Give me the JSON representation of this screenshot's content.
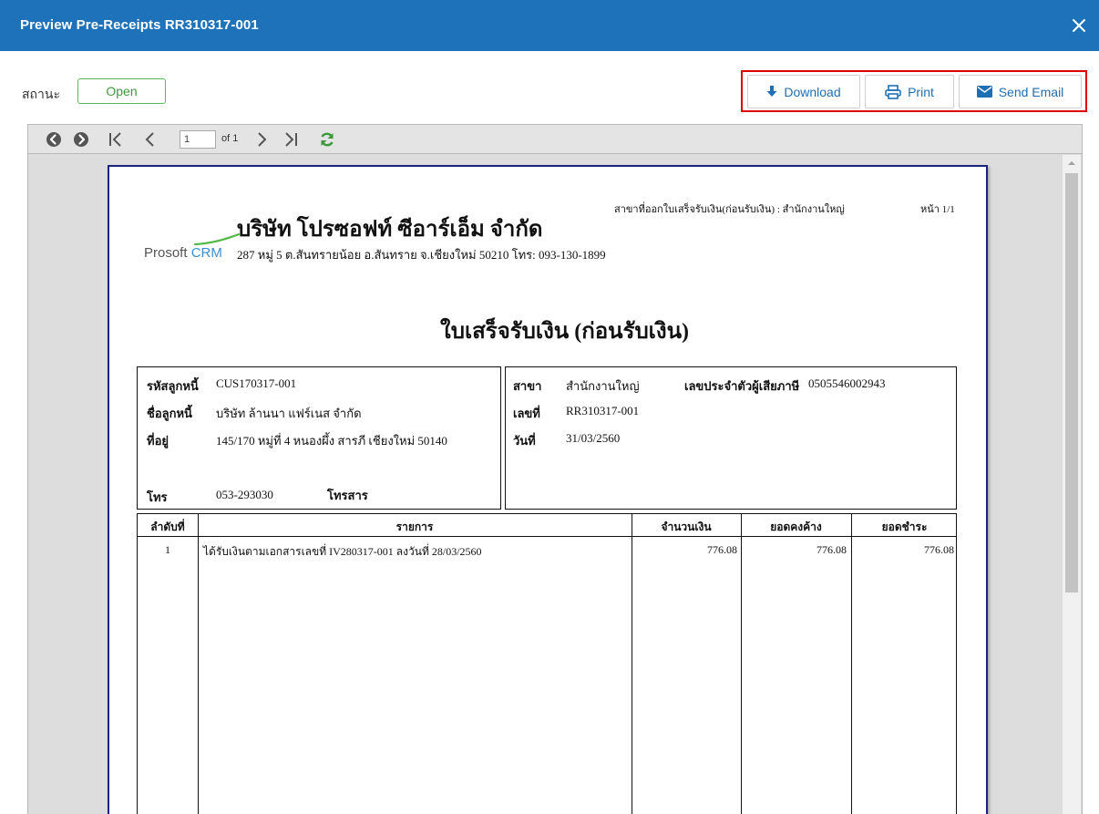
{
  "window": {
    "title": "Preview Pre-Receipts RR310317-001"
  },
  "status": {
    "label": "สถานะ",
    "value": "Open"
  },
  "actions": {
    "download": "Download",
    "print": "Print",
    "send_email": "Send Email"
  },
  "viewer_toolbar": {
    "page_current": "1",
    "page_total_label": "of 1"
  },
  "document": {
    "company_name": "บริษัท โปรซอฟท์ ซีอาร์เอ็ม จำกัด",
    "company_address": "287 หมู่ 5 ต.สันทรายน้อย อ.สันทราย จ.เชียงใหม่ 50210 โทร: 093-130-1899",
    "logo_text": "Prosoft",
    "logo_text_accent": "CRM",
    "issuing_branch": "สาขาที่ออกใบเสร็จรับเงิน(ก่อนรับเงิน) : สำนักงานใหญ่",
    "page_number": "หน้า 1/1",
    "title": "ใบเสร็จรับเงิน (ก่อนรับเงิน)",
    "customer": {
      "code_label": "รหัสลูกหนี้",
      "code": "CUS170317-001",
      "name_label": "ชื่อลูกหนี้",
      "name": "บริษัท ล้านนา แฟร์เนส จำกัด",
      "address_label": "ที่อยู่",
      "address": "145/170 หมู่ที่ 4 หนองผึ้ง สารภี เชียงใหม่ 50140",
      "phone_label": "โทร",
      "phone": "053-293030",
      "fax_label": "โทรสาร",
      "fax": ""
    },
    "info": {
      "branch_label": "สาขา",
      "branch": "สำนักงานใหญ่",
      "tax_id_label": "เลขประจำตัวผู้เสียภาษี",
      "tax_id": "0505546002943",
      "number_label": "เลขที่",
      "number": "RR310317-001",
      "date_label": "วันที่",
      "date": "31/03/2560"
    },
    "table": {
      "headers": [
        "ลำดับที่",
        "รายการ",
        "จำนวนเงิน",
        "ยอดคงค้าง",
        "ยอดชำระ"
      ],
      "rows": [
        [
          "1",
          "ได้รับเงินตามเอกสารเลขที่ IV280317-001 ลงวันที่ 28/03/2560",
          "776.08",
          "776.08",
          "776.08"
        ]
      ]
    }
  },
  "colors": {
    "title_bar": "#1e72b9",
    "status_green": "#5cb85c",
    "highlight_red": "#e00000",
    "page_border": "#1a237e"
  },
  "icons": {
    "close": "close-icon",
    "download": "download-arrow-icon",
    "print": "print-icon",
    "email": "envelope-icon",
    "back": "circle-back-icon",
    "forward": "circle-forward-icon",
    "first": "first-page-icon",
    "prev": "prev-page-icon",
    "next": "next-page-icon",
    "last": "last-page-icon",
    "refresh": "refresh-icon"
  }
}
